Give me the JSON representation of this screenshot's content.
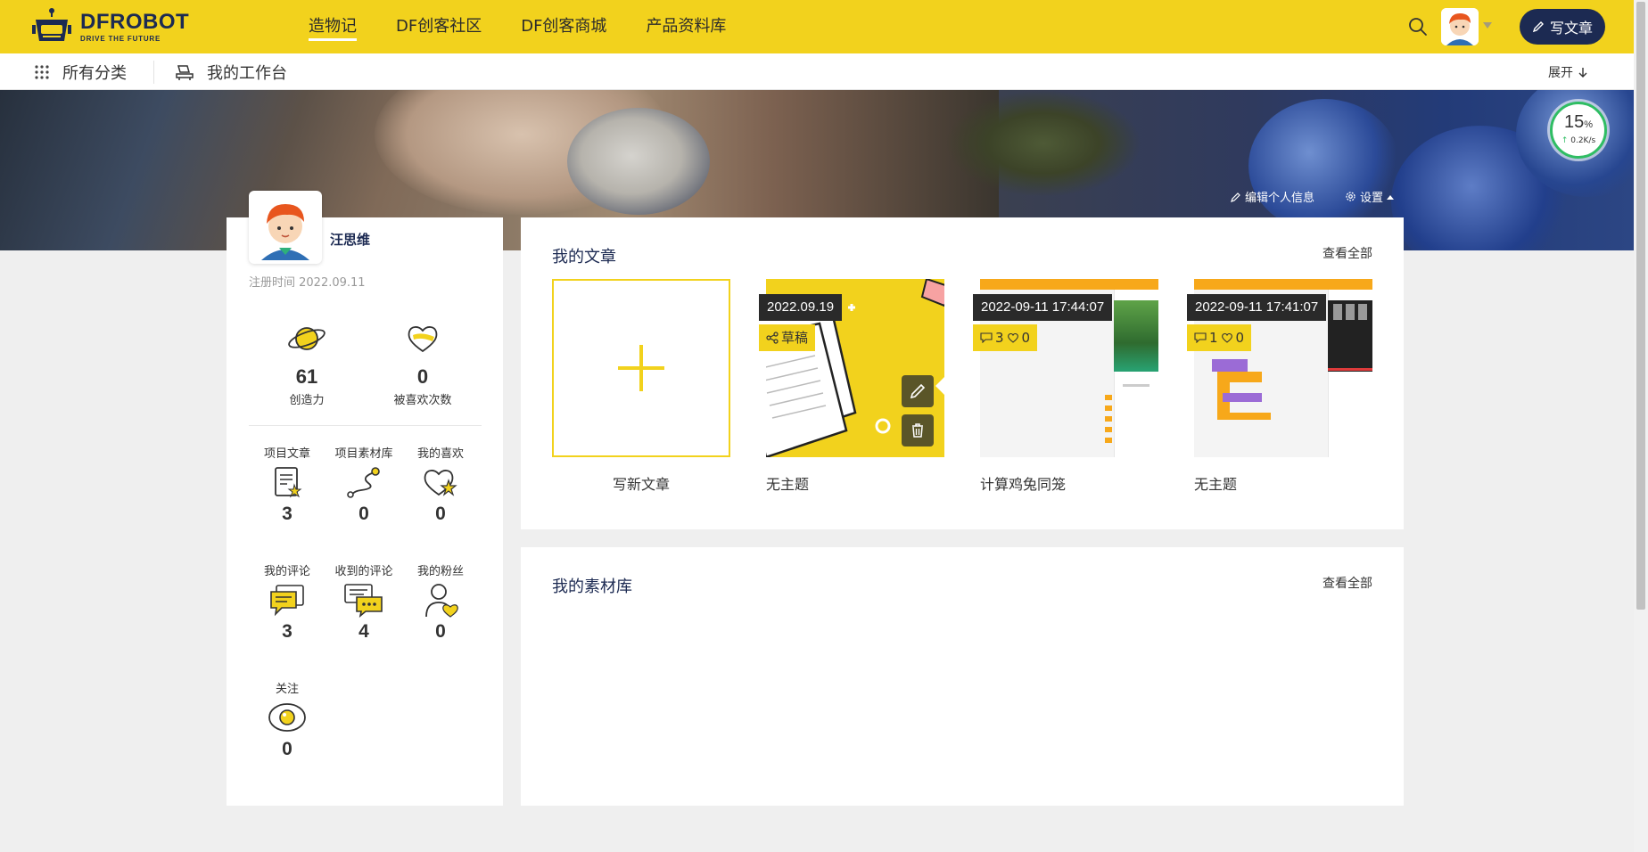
{
  "brand": {
    "name": "DFROBOT",
    "tagline": "DRIVE THE FUTURE"
  },
  "nav": {
    "items": [
      {
        "label": "造物记",
        "active": true
      },
      {
        "label": "DF创客社区",
        "active": false
      },
      {
        "label": "DF创客商城",
        "active": false
      },
      {
        "label": "产品资料库",
        "active": false
      }
    ],
    "write_label": "写文章"
  },
  "subnav": {
    "categories": "所有分类",
    "workbench": "我的工作台",
    "expand": "展开"
  },
  "banner": {
    "edit_profile": "编辑个人信息",
    "settings": "设置"
  },
  "speed_widget": {
    "percent": "15",
    "percent_unit": "%",
    "rate": "0.2K/s"
  },
  "profile": {
    "name": "汪思维",
    "registered": "注册时间 2022.09.11",
    "creativity": {
      "value": "61",
      "label": "创造力"
    },
    "likes_received": {
      "value": "0",
      "label": "被喜欢次数"
    },
    "grid": [
      {
        "label": "项目文章",
        "value": "3",
        "icon": "article-icon"
      },
      {
        "label": "项目素材库",
        "value": "0",
        "icon": "material-path-icon"
      },
      {
        "label": "我的喜欢",
        "value": "0",
        "icon": "heart-star-icon"
      },
      {
        "label": "我的评论",
        "value": "3",
        "icon": "comment-icon"
      },
      {
        "label": "收到的评论",
        "value": "4",
        "icon": "received-comments-icon"
      },
      {
        "label": "我的粉丝",
        "value": "0",
        "icon": "fans-icon"
      },
      {
        "label": "关注",
        "value": "0",
        "icon": "eye-icon"
      }
    ]
  },
  "articles": {
    "title": "我的文章",
    "view_all": "查看全部",
    "new_label": "写新文章",
    "items": [
      {
        "title": "无主题",
        "date": "2022.09.19",
        "status": "草稿"
      },
      {
        "title": "计算鸡兔同笼",
        "date": "2022-09-11 17:44:07",
        "comments": "3",
        "likes": "0"
      },
      {
        "title": "无主题",
        "date": "2022-09-11 17:41:07",
        "comments": "1",
        "likes": "0"
      }
    ]
  },
  "materials": {
    "title": "我的素材库",
    "view_all": "查看全部"
  },
  "colors": {
    "accent": "#f2d21d",
    "navy": "#1c2a52",
    "speed_green": "#2fbd63"
  }
}
